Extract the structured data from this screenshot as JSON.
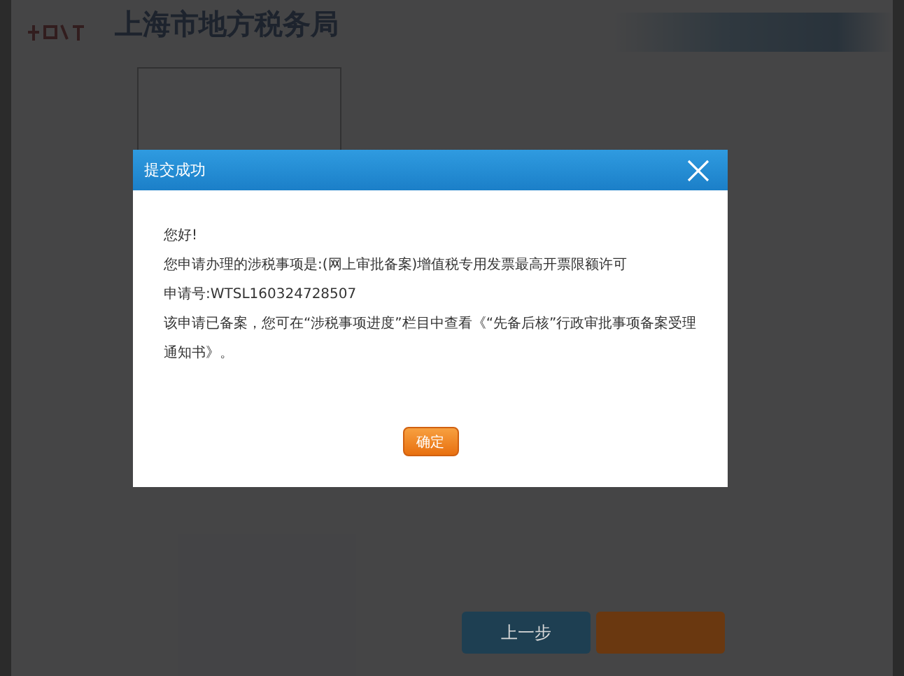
{
  "header": {
    "title": "上海市地方税务局"
  },
  "dialog": {
    "title": "提交成功",
    "lines": [
      "您好!",
      "您申请办理的涉税事项是:(网上审批备案)增值税专用发票最高开票限额许可",
      "申请号:WTSL160324728507",
      "该申请已备案，您可在“涉税事项进度”栏目中查看《“先备后核”行政审批事项备案受理通知书》。"
    ],
    "confirm": "确定"
  },
  "footer_buttons": [
    {
      "label": "上一步",
      "kind": "back"
    },
    {
      "kind": "next"
    }
  ]
}
